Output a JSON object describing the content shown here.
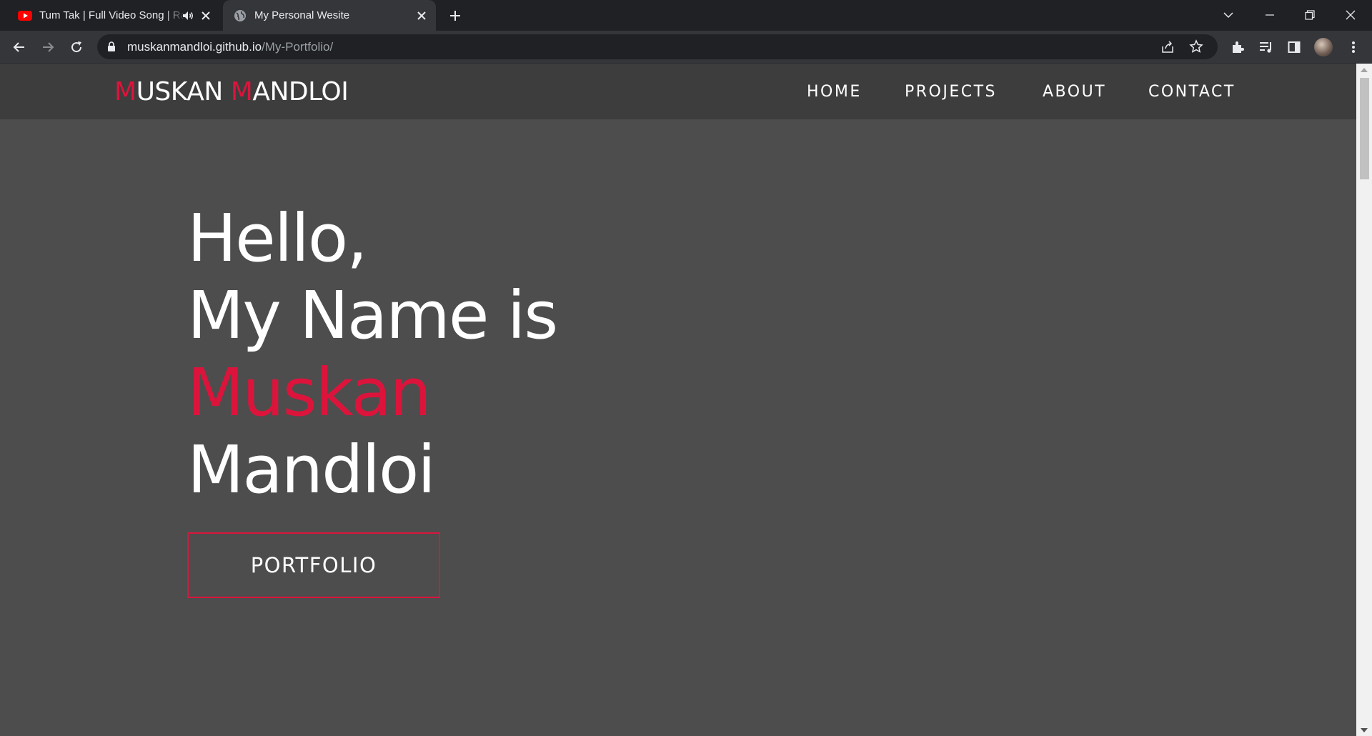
{
  "browser": {
    "tabs": [
      {
        "title": "Tum Tak | Full Video Song | Raanjhanaa",
        "favicon": "youtube-icon",
        "audio": "speaker-icon",
        "active": false
      },
      {
        "title": "My Personal Wesite",
        "favicon": "globe-icon",
        "active": true
      }
    ],
    "url_host": "muskanmandloi.github.io",
    "url_path": "/My-Portfolio/"
  },
  "site": {
    "logo": {
      "m1": "M",
      "part1": "USKAN ",
      "m2": "M",
      "part2": "ANDLOI"
    },
    "nav": [
      "HOME",
      "PROJECTS",
      "ABOUT",
      "CONTACT"
    ],
    "hero": {
      "line1": "Hello,",
      "line2": "My Name is",
      "line3": "Muskan",
      "line4": "Mandloi"
    },
    "cta": "PORTFOLIO"
  },
  "colors": {
    "accent": "#dc143c",
    "page_bg": "#4d4d4d",
    "header_bg": "#3d3d3d"
  }
}
